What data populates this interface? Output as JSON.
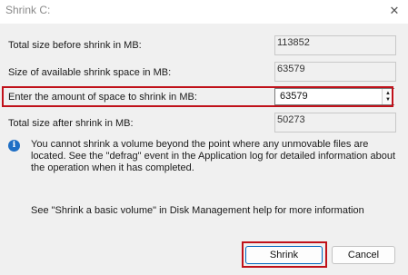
{
  "window": {
    "title": "Shrink C:",
    "close_glyph": "✕"
  },
  "rows": [
    {
      "label": "Total size before shrink in MB:",
      "value": "113852"
    },
    {
      "label": "Size of available shrink space in MB:",
      "value": "63579"
    },
    {
      "label": "Enter the amount of space to shrink in MB:",
      "value": "63579"
    },
    {
      "label": "Total size after shrink in MB:",
      "value": "50273"
    }
  ],
  "info": {
    "icon": "info-icon",
    "icon_glyph": "i",
    "text": "You cannot shrink a volume beyond the point where any unmovable files are located. See the \"defrag\" event in the Application log for detailed information about the operation when it has completed."
  },
  "help": {
    "text": "See \"Shrink a basic volume\" in Disk Management help for more information"
  },
  "buttons": {
    "shrink": "Shrink",
    "cancel": "Cancel"
  },
  "spinner": {
    "up": "▲",
    "down": "▼"
  },
  "colors": {
    "highlight": "#c0111a",
    "info_icon": "#1f6fc5",
    "primary_border": "#0067c0"
  }
}
